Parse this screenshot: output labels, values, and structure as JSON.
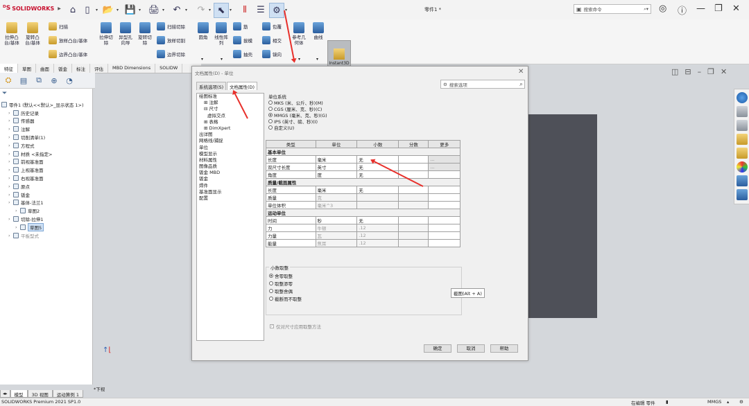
{
  "titlebar": {
    "brand": "SOLIDWORKS",
    "doc_title": "零件1 *",
    "search_placeholder": "搜索命令",
    "search_icon": "search-icon",
    "help": "?"
  },
  "ribbon": {
    "big": [
      {
        "label": "拉伸凸\n台/基体"
      },
      {
        "label": "旋转凸\n台/基体"
      },
      {
        "label": "拉伸切\n除"
      },
      {
        "label": "异型孔\n向导"
      },
      {
        "label": "旋转切\n除"
      },
      {
        "label": "圆角"
      },
      {
        "label": "线性阵\n列"
      },
      {
        "label": "参考几\n何体"
      },
      {
        "label": "曲线"
      },
      {
        "label": "Instant3D"
      }
    ],
    "small": [
      "扫描",
      "放样凸台/基体",
      "边界凸台/基体",
      "扫描切除",
      "放样切割",
      "边界切除",
      "筋",
      "拔模",
      "抽壳",
      "包覆",
      "相交",
      "镜向"
    ]
  },
  "cmd_tabs": [
    "特征",
    "草图",
    "曲面",
    "钣金",
    "标注",
    "评估",
    "MBD Dimensions",
    "SOLIDW"
  ],
  "feature_tree": [
    {
      "label": "零件1 (默认<<默认>_显示状态 1>)",
      "indent": 0
    },
    {
      "label": "历史记录",
      "indent": 1
    },
    {
      "label": "传感器",
      "indent": 1
    },
    {
      "label": "注解",
      "indent": 1
    },
    {
      "label": "切削清单(1)",
      "indent": 1
    },
    {
      "label": "方程式",
      "indent": 1
    },
    {
      "label": "材质 <未指定>",
      "indent": 1
    },
    {
      "label": "前视基准面",
      "indent": 1
    },
    {
      "label": "上视基准面",
      "indent": 1
    },
    {
      "label": "右视基准面",
      "indent": 1
    },
    {
      "label": "原点",
      "indent": 1
    },
    {
      "label": "钣金",
      "indent": 1
    },
    {
      "label": "基体-法兰1",
      "indent": 1
    },
    {
      "label": "草图2",
      "indent": 2
    },
    {
      "label": "切除-拉伸1",
      "indent": 1
    },
    {
      "label": "草图5",
      "indent": 2,
      "selected": true
    },
    {
      "label": "平板型式",
      "indent": 1,
      "gray": true
    }
  ],
  "bottom_tabs": [
    "模型",
    "3D 视图",
    "运动算例 1"
  ],
  "view_label": "*下视",
  "status": {
    "left": "SOLIDWORKS Premium 2021 SP1.0",
    "editing": "在编辑 零件",
    "units": "MMGS"
  },
  "dialog": {
    "title": "文档属性(D) - 单位",
    "tabs": [
      "系统选项(S)",
      "文档属性(D)"
    ],
    "search_placeholder": "搜索选项",
    "categories": [
      {
        "label": "绘图标准",
        "level": 0
      },
      {
        "label": "⊞ 注解",
        "level": 1
      },
      {
        "label": "⊟ 尺寸",
        "level": 1
      },
      {
        "label": "虚拟交点",
        "level": 2
      },
      {
        "label": "⊞ 表格",
        "level": 1
      },
      {
        "label": "⊞ DimXpert",
        "level": 1
      },
      {
        "label": "出详图",
        "level": 0
      },
      {
        "label": "网格线/捕捉",
        "level": 0
      },
      {
        "label": "单位",
        "level": 0
      },
      {
        "label": "模型显示",
        "level": 0
      },
      {
        "label": "材料属性",
        "level": 0
      },
      {
        "label": "图像品质",
        "level": 0
      },
      {
        "label": "钣金 MBD",
        "level": 0
      },
      {
        "label": "钣金",
        "level": 0
      },
      {
        "label": "焊件",
        "level": 0
      },
      {
        "label": "基准面显示",
        "level": 0
      },
      {
        "label": "配置",
        "level": 0
      }
    ],
    "unit_system": {
      "title": "单位系统",
      "options": [
        {
          "label": "MKS (米、公斤、秒)(M)",
          "checked": false
        },
        {
          "label": "CGS (厘米、克、秒)(C)",
          "checked": false
        },
        {
          "label": "MMGS (毫米、克、秒)(G)",
          "checked": true
        },
        {
          "label": "IPS (英寸、磅、秒)(I)",
          "checked": false
        },
        {
          "label": "自定义(U)",
          "checked": false
        }
      ]
    },
    "table": {
      "headers": [
        "类型",
        "单位",
        "小数",
        "分数",
        "更多"
      ],
      "sections": [
        {
          "title": "基本单位",
          "rows": [
            {
              "type": "长度",
              "unit": "毫米",
              "decimal": "无",
              "fraction": "",
              "more": true,
              "disabled": false
            },
            {
              "type": "双尺寸长度",
              "unit": "英寸",
              "decimal": "无",
              "fraction": "",
              "more": true,
              "disabled": false
            },
            {
              "type": "角度",
              "unit": "度",
              "decimal": "无",
              "fraction": "",
              "more": false,
              "disabled": false
            }
          ]
        },
        {
          "title": "质量/截面属性",
          "rows": [
            {
              "type": "长度",
              "unit": "毫米",
              "decimal": "无",
              "fraction": "",
              "more": false,
              "disabled": false
            },
            {
              "type": "质量",
              "unit": "克",
              "decimal": "",
              "fraction": "",
              "more": false,
              "disabled": true
            },
            {
              "type": "单位体积",
              "unit": "毫米^3",
              "decimal": "",
              "fraction": "",
              "more": false,
              "disabled": true
            }
          ]
        },
        {
          "title": "运动单位",
          "rows": [
            {
              "type": "时间",
              "unit": "秒",
              "decimal": "无",
              "fraction": "",
              "more": false,
              "disabled": false
            },
            {
              "type": "力",
              "unit": "牛顿",
              "decimal": ".12",
              "fraction": "",
              "more": false,
              "disabled": true
            },
            {
              "type": "力量",
              "unit": "瓦",
              "decimal": ".12",
              "fraction": "",
              "more": false,
              "disabled": true
            },
            {
              "type": "能量",
              "unit": "焦耳",
              "decimal": ".12",
              "fraction": "",
              "more": false,
              "disabled": true
            }
          ]
        }
      ]
    },
    "rounding": {
      "title": "小数取整",
      "options": [
        {
          "label": "舍零取整",
          "checked": true
        },
        {
          "label": "取整添零",
          "checked": false
        },
        {
          "label": "取整舍偶",
          "checked": false
        },
        {
          "label": "截断而不取整",
          "checked": false
        }
      ]
    },
    "checkbox_label": "仅对尺寸应用取整方法",
    "buttons": {
      "ok": "确定",
      "cancel": "取消",
      "help": "帮助"
    }
  },
  "tooltip": "截图(Alt + A)",
  "colors": {
    "arrow": "#e8302b",
    "selection": "#cde0f5",
    "brand": "#c8102e"
  }
}
